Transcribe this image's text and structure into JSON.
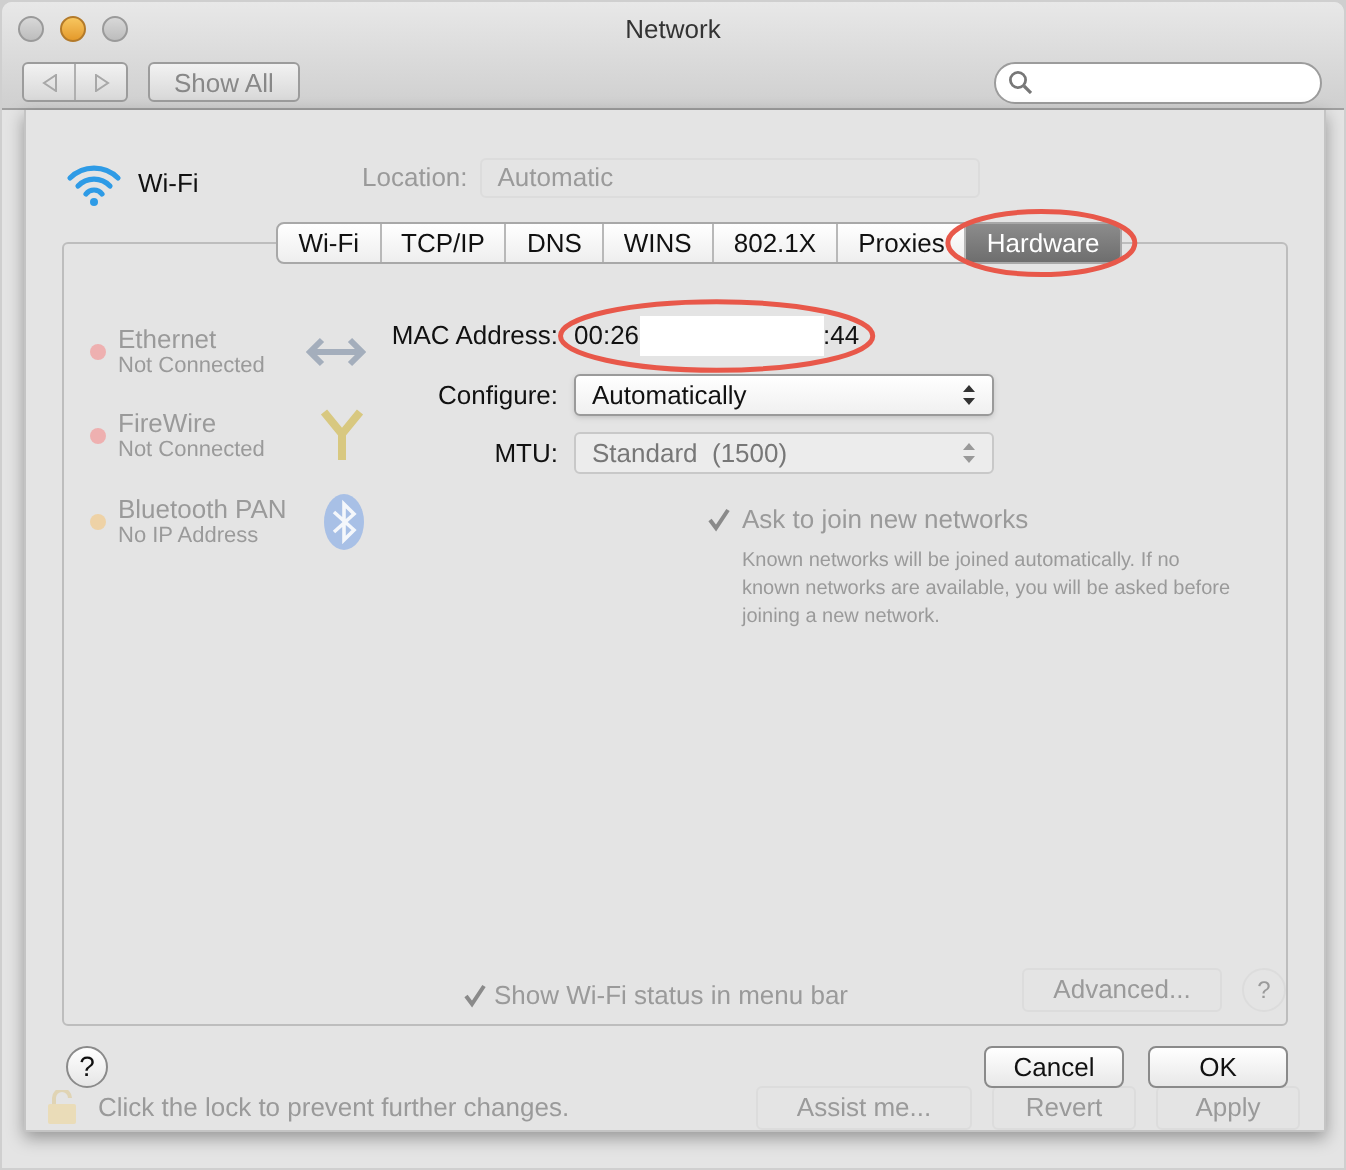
{
  "window": {
    "title": "Network"
  },
  "toolbar": {
    "show_all": "Show All"
  },
  "background": {
    "location": {
      "label": "Location:",
      "value": "Automatic"
    },
    "services": [
      {
        "name": "Ethernet",
        "status": "Not Connected",
        "color": "#eeb0b0",
        "kind": "ethernet"
      },
      {
        "name": "FireWire",
        "status": "Not Connected",
        "color": "#eeb0b0",
        "kind": "firewire"
      },
      {
        "name": "Bluetooth PAN",
        "status": "No IP Address",
        "color": "#eed2a6",
        "kind": "bluetooth"
      }
    ],
    "ask_to_join": {
      "label": "Ask to join new networks",
      "checked": true,
      "description": "Known networks will be joined automatically. If no known networks are available, you will be asked before joining a new network."
    },
    "show_status": {
      "label": "Show Wi-Fi status in menu bar",
      "checked": true
    },
    "advanced": "Advanced...",
    "help": "?",
    "lock_text": "Click the lock to prevent further changes.",
    "assist": "Assist me...",
    "revert": "Revert",
    "apply": "Apply"
  },
  "sheet": {
    "service": "Wi-Fi",
    "tabs": [
      {
        "label": "Wi-Fi",
        "selected": false,
        "circled": false
      },
      {
        "label": "TCP/IP",
        "selected": false,
        "circled": false
      },
      {
        "label": "DNS",
        "selected": false,
        "circled": false
      },
      {
        "label": "WINS",
        "selected": false,
        "circled": false
      },
      {
        "label": "802.1X",
        "selected": false,
        "circled": false
      },
      {
        "label": "Proxies",
        "selected": false,
        "circled": false
      },
      {
        "label": "Hardware",
        "selected": true,
        "circled": true
      }
    ],
    "fields": [
      {
        "label": "MAC Address:",
        "kind": "text",
        "value_start": "00:26",
        "value_end": ":44",
        "circled": true
      },
      {
        "label": "Configure:",
        "kind": "select",
        "value": "Automatically",
        "disabled": false
      },
      {
        "label": "MTU:",
        "kind": "select",
        "value": "Standard  (1500)",
        "disabled": true
      }
    ],
    "help": "?",
    "buttons": [
      {
        "label": "Cancel"
      },
      {
        "label": "OK"
      }
    ]
  }
}
